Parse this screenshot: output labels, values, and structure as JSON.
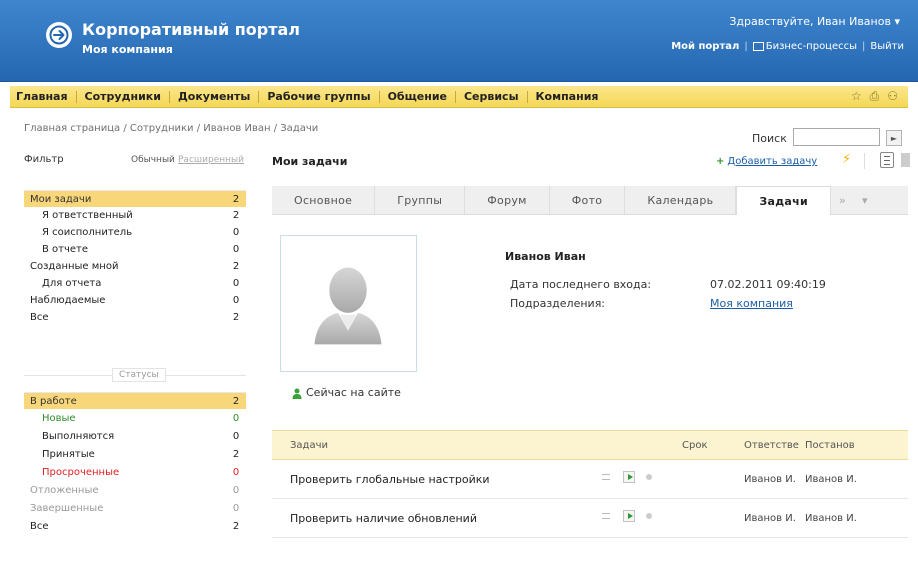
{
  "header": {
    "title": "Корпоративный портал",
    "company": "Моя компания",
    "greeting": "Здравствуйте, Иван Иванов",
    "greeting_arrow": "▾",
    "my_portal": "Мой портал",
    "business_processes": "Бизнес-процессы",
    "logout": "Выйти",
    "sep": "|"
  },
  "menu": {
    "items": [
      "Главная",
      "Сотрудники",
      "Документы",
      "Рабочие группы",
      "Общение",
      "Сервисы",
      "Компания"
    ],
    "icons": [
      "star-icon",
      "print-icon",
      "users-icon"
    ],
    "icon_glyphs": [
      "☆",
      "⎙",
      "⚇"
    ]
  },
  "breadcrumb": "Главная страница / Сотрудники / Иванов Иван / Задачи",
  "search": {
    "label": "Поиск",
    "value": "",
    "button": "►"
  },
  "filter": {
    "label": "Фильтр",
    "mode_normal": "Обычный",
    "mode_extended": "Расширенный",
    "roles": [
      {
        "label": "Мои задачи",
        "count": "2",
        "indent": false,
        "selected": true
      },
      {
        "label": "Я ответственный",
        "count": "2",
        "indent": true
      },
      {
        "label": "Я соисполнитель",
        "count": "0",
        "indent": true
      },
      {
        "label": "В отчете",
        "count": "0",
        "indent": true
      },
      {
        "label": "Созданные мной",
        "count": "2",
        "indent": false
      },
      {
        "label": "Для отчета",
        "count": "0",
        "indent": true
      },
      {
        "label": "Наблюдаемые",
        "count": "0",
        "indent": false
      },
      {
        "label": "Все",
        "count": "2",
        "indent": false
      }
    ],
    "statuses_title": "Статусы",
    "statuses": [
      {
        "label": "В работе",
        "count": "2",
        "color": "#333333",
        "selected": true
      },
      {
        "label": "Новые",
        "count": "0",
        "color": "#2e8b2e",
        "indent": true
      },
      {
        "label": "Выполняются",
        "count": "0",
        "color": "#222222",
        "indent": true
      },
      {
        "label": "Принятые",
        "count": "2",
        "color": "#222222",
        "indent": true
      },
      {
        "label": "Просроченные",
        "count": "0",
        "color": "#e02020",
        "indent": true
      },
      {
        "label": "Отложенные",
        "count": "0",
        "color": "#999999"
      },
      {
        "label": "Завершенные",
        "count": "0",
        "color": "#999999"
      },
      {
        "label": "Все",
        "count": "2",
        "color": "#222222"
      }
    ]
  },
  "main": {
    "title": "Мои задачи",
    "add_task_plus": "+",
    "add_task": "Добавить задачу",
    "bolt": "⚡",
    "tabs": [
      "Основное",
      "Группы",
      "Форум",
      "Фото",
      "Календарь",
      "Задачи"
    ],
    "active_tab": "Задачи",
    "tabs_more": "»",
    "tabs_menu": "▾"
  },
  "profile": {
    "name": "Иванов Иван",
    "last_login_label": "Дата последнего входа:",
    "last_login_value": "07.02.2011 09:40:19",
    "departments_label": "Подразделения:",
    "departments_value": "Моя компания",
    "online_status": "Сейчас на сайте"
  },
  "tasks": {
    "headers": {
      "task": "Задачи",
      "deadline": "Срок",
      "responsible": "Ответстве",
      "creator": "Постанов"
    },
    "rows": [
      {
        "name": "Проверить глобальные настройки",
        "deadline": "",
        "responsible": "Иванов И.",
        "creator": "Иванов И."
      },
      {
        "name": "Проверить наличие обновлений",
        "deadline": "",
        "responsible": "Иванов И.",
        "creator": "Иванов И."
      }
    ]
  },
  "colors": {
    "header_blue": "#2f78c3",
    "menu_yellow": "#f6dc6a",
    "selected_row": "#f8d67a",
    "link": "#1b5fa9",
    "add_green": "#2c9a2c"
  }
}
